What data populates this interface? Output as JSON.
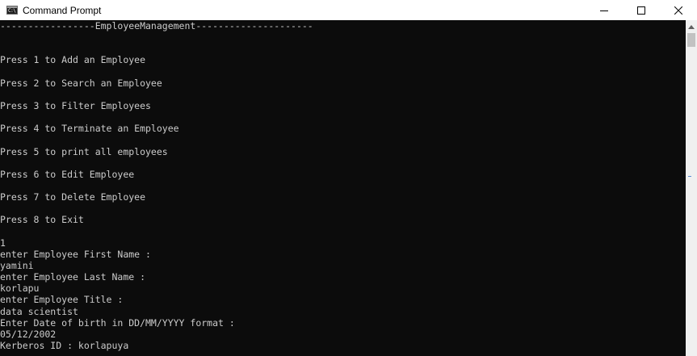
{
  "window": {
    "title": "Command Prompt",
    "icon": "cmd-icon",
    "icon_text": "C:\\",
    "controls": [
      "minimize-icon",
      "maximize-icon",
      "close-icon"
    ]
  },
  "console": {
    "lines": [
      "-----------------EmployeeManagement---------------------",
      "",
      "",
      "Press 1 to Add an Employee",
      "",
      "Press 2 to Search an Employee",
      "",
      "Press 3 to Filter Employees",
      "",
      "Press 4 to Terminate an Employee",
      "",
      "Press 5 to print all employees",
      "",
      "Press 6 to Edit Employee",
      "",
      "Press 7 to Delete Employee",
      "",
      "Press 8 to Exit",
      "",
      "1",
      "enter Employee First Name :",
      "yamini",
      "enter Employee Last Name :",
      "korlapu",
      "enter Employee Title :",
      "data scientist",
      "Enter Date of birth in DD/MM/YYYY format :",
      "05/12/2002",
      "Kerberos ID : korlapuya"
    ]
  },
  "colors": {
    "background": "#0c0c0c",
    "text": "#cccccc",
    "titlebar": "#ffffff",
    "scrollbar": "#f0f0f0"
  }
}
